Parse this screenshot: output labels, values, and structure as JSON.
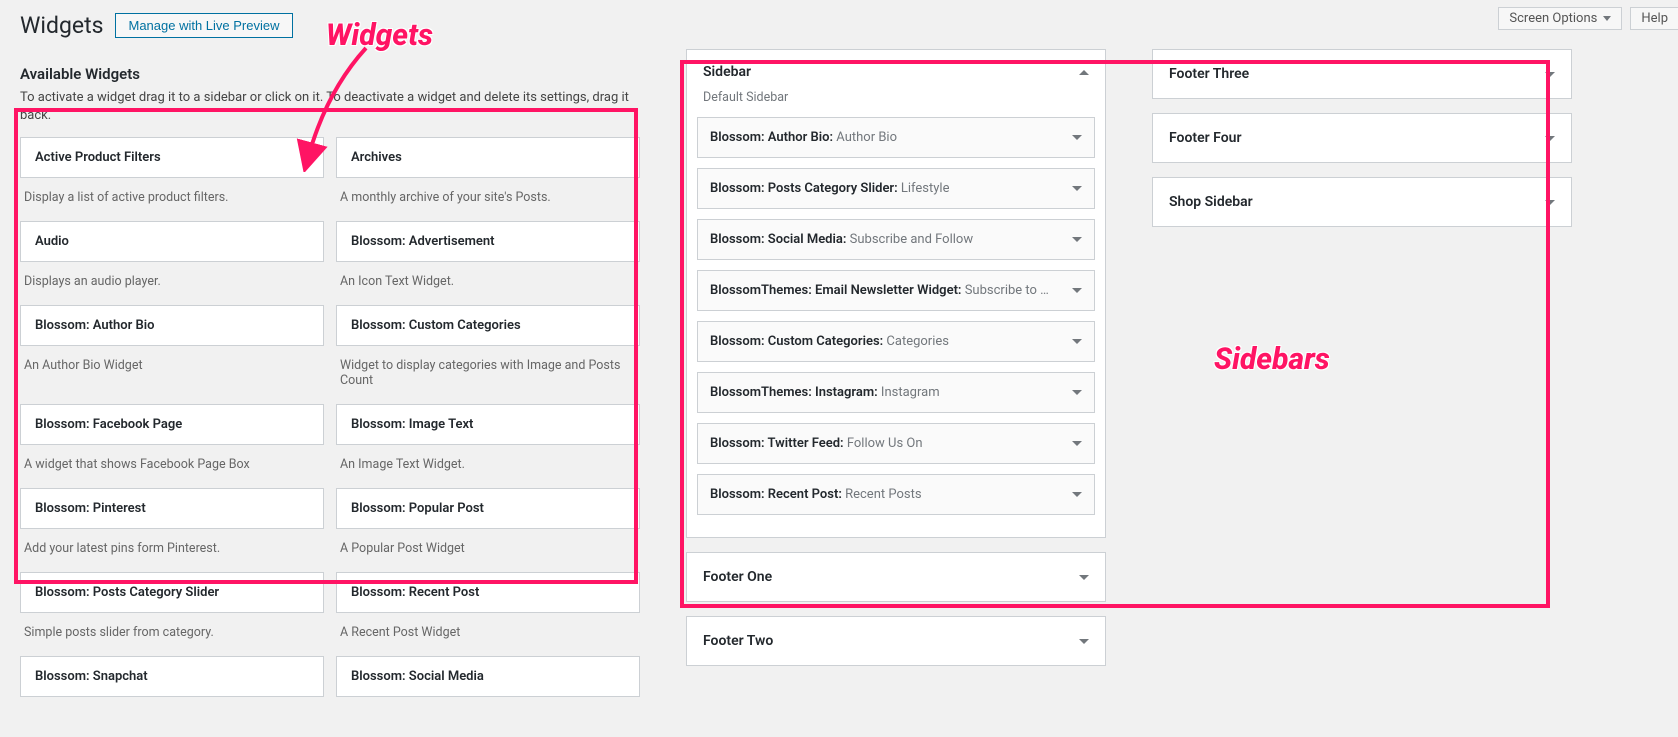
{
  "topbar": {
    "screen_options": "Screen Options",
    "help": "Help"
  },
  "header": {
    "title": "Widgets",
    "preview_btn": "Manage with Live Preview"
  },
  "available": {
    "heading": "Available Widgets",
    "description": "To activate a widget drag it to a sidebar or click on it. To deactivate a widget and delete its settings, drag it back.",
    "widgets": [
      {
        "title": "Active Product Filters",
        "desc": "Display a list of active product filters."
      },
      {
        "title": "Archives",
        "desc": "A monthly archive of your site's Posts."
      },
      {
        "title": "Audio",
        "desc": "Displays an audio player."
      },
      {
        "title": "Blossom: Advertisement",
        "desc": "An Icon Text Widget."
      },
      {
        "title": "Blossom: Author Bio",
        "desc": "An Author Bio Widget"
      },
      {
        "title": "Blossom: Custom Categories",
        "desc": "Widget to display categories with Image and Posts Count"
      },
      {
        "title": "Blossom: Facebook Page",
        "desc": "A widget that shows Facebook Page Box"
      },
      {
        "title": "Blossom: Image Text",
        "desc": "An Image Text Widget."
      },
      {
        "title": "Blossom: Pinterest",
        "desc": "Add your latest pins form Pinterest."
      },
      {
        "title": "Blossom: Popular Post",
        "desc": "A Popular Post Widget"
      },
      {
        "title": "Blossom: Posts Category Slider",
        "desc": "Simple posts slider from category."
      },
      {
        "title": "Blossom: Recent Post",
        "desc": "A Recent Post Widget"
      },
      {
        "title": "Blossom: Snapchat",
        "desc": ""
      },
      {
        "title": "Blossom: Social Media",
        "desc": ""
      }
    ]
  },
  "sidebar_areas": {
    "mid": [
      {
        "title": "Sidebar",
        "desc": "Default Sidebar",
        "expanded": true,
        "items": [
          {
            "name": "Blossom: Author Bio",
            "value": "Author Bio"
          },
          {
            "name": "Blossom: Posts Category Slider",
            "value": "Lifestyle"
          },
          {
            "name": "Blossom: Social Media",
            "value": "Subscribe and Follow"
          },
          {
            "name": "BlossomThemes: Email Newsletter Widget",
            "value": "Subscribe to …"
          },
          {
            "name": "Blossom: Custom Categories",
            "value": "Categories"
          },
          {
            "name": "BlossomThemes: Instagram",
            "value": "Instagram"
          },
          {
            "name": "Blossom: Twitter Feed",
            "value": "Follow Us On"
          },
          {
            "name": "Blossom: Recent Post",
            "value": "Recent Posts"
          }
        ]
      },
      {
        "title": "Footer One",
        "expanded": false
      },
      {
        "title": "Footer Two",
        "expanded": false
      }
    ],
    "right": [
      {
        "title": "Footer Three",
        "expanded": false
      },
      {
        "title": "Footer Four",
        "expanded": false
      },
      {
        "title": "Shop Sidebar",
        "expanded": false
      }
    ]
  },
  "annotations": {
    "widgets_label": "Widgets",
    "sidebars_label": "Sidebars"
  }
}
